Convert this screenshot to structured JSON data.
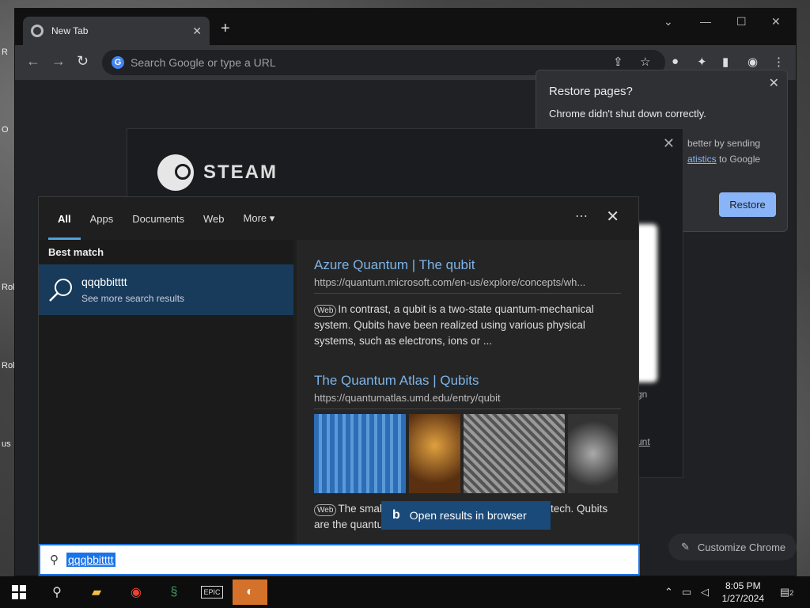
{
  "desktop": {
    "side_labels": [
      "R",
      "O",
      "Rol",
      "Rol",
      "us"
    ]
  },
  "chrome": {
    "tab_title": "New Tab",
    "omnibox_placeholder": "Search Google or type a URL",
    "restore": {
      "title": "Restore pages?",
      "subtitle": "Chrome didn't shut down correctly.",
      "frag1": "better by sending",
      "frag2_link": "atistics",
      "frag2_rest": " to Google",
      "button": "Restore"
    },
    "customize_label": "Customize Chrome"
  },
  "steam": {
    "wordmark": "STEAM",
    "frag1": "gn",
    "frag2": "unt"
  },
  "search_panel": {
    "tabs": [
      "All",
      "Apps",
      "Documents",
      "Web",
      "More"
    ],
    "best_match_label": "Best match",
    "best_match": {
      "title": "qqqbbitttt",
      "subtitle": "See more search results"
    },
    "results": [
      {
        "title": "Azure Quantum | The qubit",
        "url": "https://quantum.microsoft.com/en-us/explore/concepts/wh...",
        "badge": "Web",
        "snippet": "In contrast, a qubit is a two-state quantum-mechanical system. Qubits have been realized using various physical systems, such as electrons, ions or ..."
      },
      {
        "title": "The Quantum Atlas | Qubits",
        "url": "https://quantumatlas.umd.edu/entry/qubit",
        "badge": "Web",
        "snippet": "The smal are the building blocks of quantum tech. Qubits are the quantum"
      }
    ],
    "open_in_browser": "Open results in browser",
    "query": "qqqbbitttt"
  },
  "taskbar": {
    "time": "8:05 PM",
    "date": "1/27/2024",
    "notification_count": "2"
  }
}
